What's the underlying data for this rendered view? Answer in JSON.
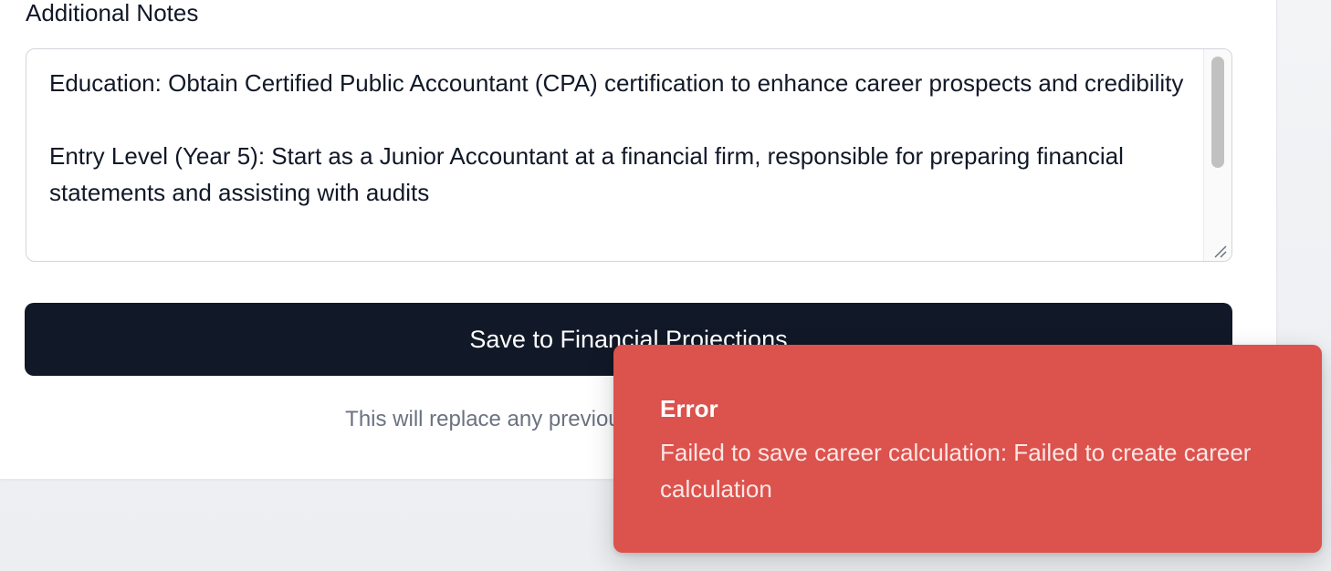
{
  "notes": {
    "label": "Additional Notes",
    "paragraphs": [
      "Education: Obtain Certified Public Accountant (CPA) certification to enhance career prospects and credibility",
      "Entry Level (Year 5): Start as a Junior Accountant at a financial firm, responsible for preparing financial statements and assisting with audits"
    ]
  },
  "actions": {
    "save_label": "Save to Financial Projections",
    "helper_text": "This will replace any previously included career calculation"
  },
  "toast": {
    "title": "Error",
    "message": "Failed to save career calculation: Failed to create career calculation",
    "color": "#dc524c"
  },
  "colors": {
    "button_bg": "#111827",
    "text": "#111827",
    "muted": "#6b7280"
  }
}
